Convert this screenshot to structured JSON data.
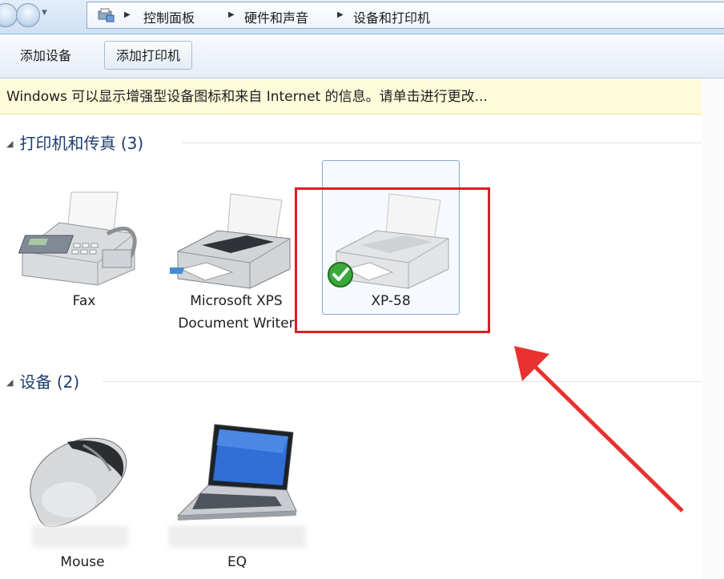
{
  "breadcrumb": {
    "items": [
      "控制面板",
      "硬件和声音",
      "设备和打印机"
    ]
  },
  "toolbar": {
    "add_device_label": "添加设备",
    "add_printer_label": "添加打印机"
  },
  "infobar": {
    "text": "Windows 可以显示增强型设备图标和来自 Internet 的信息。请单击进行更改..."
  },
  "groups": {
    "printers": {
      "title": "打印机和传真 (3)",
      "devices": [
        {
          "label": "Fax",
          "icon": "fax-icon"
        },
        {
          "label": "Microsoft XPS Document Writer",
          "icon": "printer-icon"
        },
        {
          "label": "XP-58",
          "icon": "printer-icon",
          "status": "default-printer-check"
        }
      ]
    },
    "devices": {
      "title": "设备 (2)",
      "devices": [
        {
          "label": "Mouse",
          "icon": "mouse-icon"
        },
        {
          "label": "EQ",
          "icon": "laptop-icon"
        }
      ]
    }
  },
  "annotation": {
    "highlight_color": "#d81f26",
    "arrow_color": "#e8322f"
  }
}
